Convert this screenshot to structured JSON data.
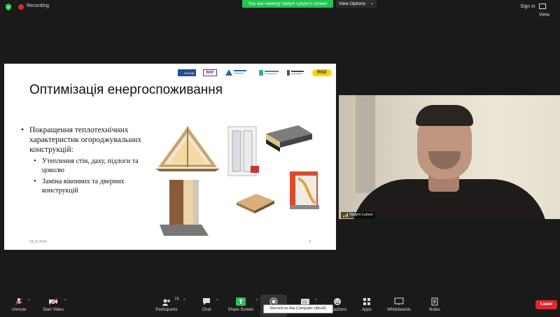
{
  "top_bar": {
    "recording_label": "Recording",
    "banner_text": "You are viewing Vadym Lytvyn's screen",
    "view_options_label": "View Options",
    "sign_in_label": "Sign in",
    "view_label": "View"
  },
  "slide": {
    "title": "Оптимізація енергоспоживання",
    "bullet_main": "Покращення теплотехнічних характеристик огороджувальних конструкцій:",
    "sub_bullets": [
      "Утеплення стін, даху, підлоги та цоколю",
      "Заміна віконних та дверних конструкцій"
    ],
    "logos": {
      "eu": "РАЗОМ",
      "brp": "BRP",
      "rise": "RISE"
    },
    "footer_date": "24.10.2024",
    "footer_page": "4"
  },
  "participant": {
    "name": "Vadym Lytvyn"
  },
  "toolbar": {
    "unmute": "Unmute",
    "start_video": "Start Video",
    "participants": "Participants",
    "participants_count": "78",
    "chat": "Chat",
    "share_screen": "Share Screen",
    "record_tooltip": "Record on this Computer (Alt+R)",
    "reactions": "Reactions",
    "apps": "Apps",
    "whiteboards": "Whiteboards",
    "notes": "Notes",
    "leave": "Leave"
  },
  "colors": {
    "accent_green": "#23c552",
    "leave_red": "#e02828",
    "background": "#1a1a1a"
  }
}
